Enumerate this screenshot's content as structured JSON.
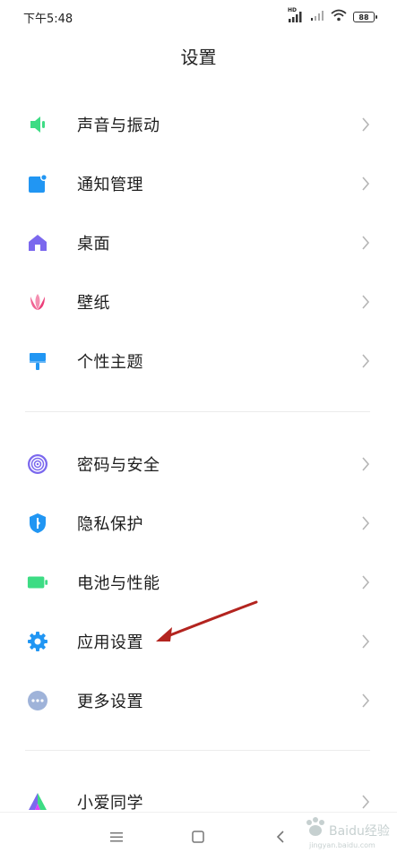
{
  "status_bar": {
    "time": "下午5:48",
    "signal_badge": "HD",
    "battery": "88"
  },
  "header": {
    "title": "设置"
  },
  "groups": [
    {
      "items": [
        {
          "label": "声音与振动",
          "icon": "speaker-icon",
          "color": "#3ddc84"
        },
        {
          "label": "通知管理",
          "icon": "notification-icon",
          "color": "#2196f3"
        },
        {
          "label": "桌面",
          "icon": "home-icon",
          "color": "#7b68ee"
        },
        {
          "label": "壁纸",
          "icon": "tulip-icon",
          "color": "#f06292"
        },
        {
          "label": "个性主题",
          "icon": "brush-icon",
          "color": "#2196f3"
        }
      ]
    },
    {
      "items": [
        {
          "label": "密码与安全",
          "icon": "fingerprint-icon",
          "color": "#7b68ee"
        },
        {
          "label": "隐私保护",
          "icon": "privacy-shield-icon",
          "color": "#2196f3"
        },
        {
          "label": "电池与性能",
          "icon": "battery-icon",
          "color": "#3ddc84"
        },
        {
          "label": "应用设置",
          "icon": "gear-icon",
          "color": "#2196f3"
        },
        {
          "label": "更多设置",
          "icon": "more-icon",
          "color": "#9fb3d9"
        }
      ]
    },
    {
      "items": [
        {
          "label": "小爱同学",
          "icon": "xiaoai-icon",
          "color": "#3ddc84"
        }
      ]
    }
  ],
  "annotation": {
    "type": "red-arrow",
    "color": "#b3241f",
    "target": "应用设置"
  },
  "nav_bar": {
    "buttons": [
      "menu",
      "home",
      "back"
    ]
  },
  "watermark": {
    "text": "Baidu经验",
    "sub": "jingyan.baidu.com"
  }
}
